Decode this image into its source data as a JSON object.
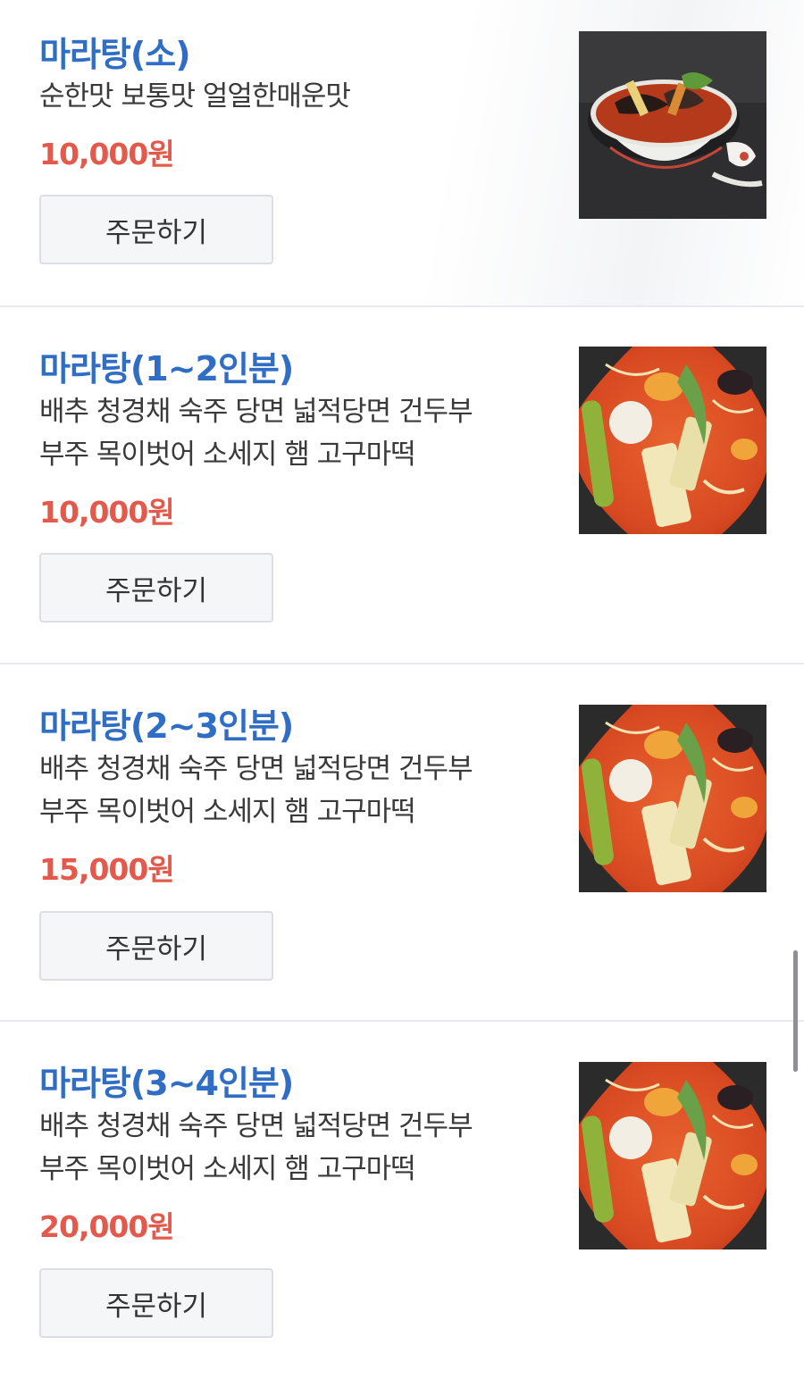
{
  "menu": {
    "order_label": "주문하기",
    "items": [
      {
        "name": "마라탕(소)",
        "desc_lines": [
          "순한맛 보통맛 얼얼한매운맛"
        ],
        "price": "10,000원",
        "image": "mala-tang-bowl-photo"
      },
      {
        "name": "마라탕(1~2인분)",
        "desc_lines": [
          "배추 청경채 숙주 당면 넓적당면 건두부",
          "부주 목이벗어 소세지 햄 고구마떡"
        ],
        "price": "10,000원",
        "image": "mala-tang-soup-photo"
      },
      {
        "name": "마라탕(2~3인분)",
        "desc_lines": [
          "배추 청경채 숙주 당면 넓적당면 건두부",
          "부주 목이벗어 소세지 햄 고구마떡"
        ],
        "price": "15,000원",
        "image": "mala-tang-soup-photo"
      },
      {
        "name": "마라탕(3~4인분)",
        "desc_lines": [
          "배추 청경채 숙주 당면 넓적당면 건두부",
          "부주 목이벗어 소세지 햄 고구마떡"
        ],
        "price": "20,000원",
        "image": "mala-tang-soup-photo"
      }
    ]
  },
  "colors": {
    "name": "#2f6ec4",
    "price": "#e35a4c",
    "button_bg": "#f5f6f8"
  }
}
